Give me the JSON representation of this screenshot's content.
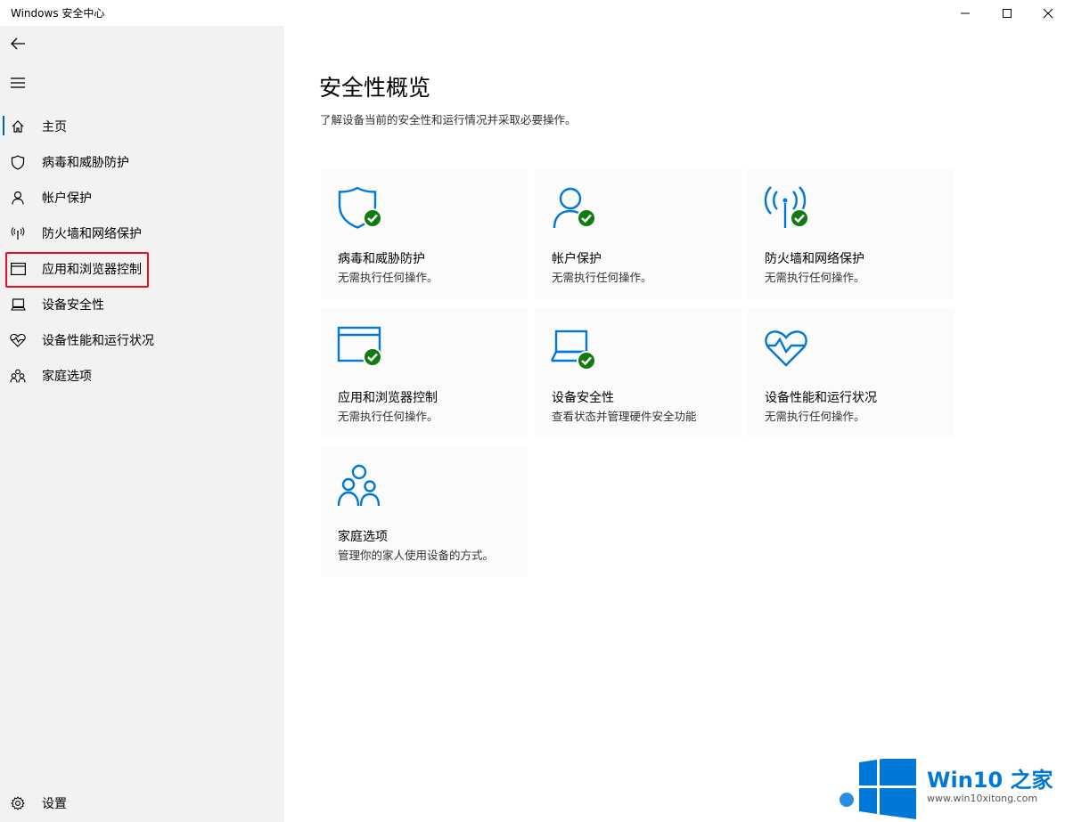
{
  "window": {
    "title": "Windows 安全中心"
  },
  "titlebar_buttons": [
    "minimize-icon",
    "maximize-icon",
    "close-icon"
  ],
  "sidebar": {
    "back_icon": "back-arrow-icon",
    "menu_icon": "hamburger-icon",
    "items": [
      {
        "label": "主页",
        "icon": "home-icon",
        "active": true
      },
      {
        "label": "病毒和威胁防护",
        "icon": "shield-icon"
      },
      {
        "label": "帐户保护",
        "icon": "person-icon"
      },
      {
        "label": "防火墙和网络保护",
        "icon": "antenna-icon"
      },
      {
        "label": "应用和浏览器控制",
        "icon": "browser-window-icon",
        "highlighted": true
      },
      {
        "label": "设备安全性",
        "icon": "laptop-icon"
      },
      {
        "label": "设备性能和运行状况",
        "icon": "heart-pulse-icon"
      },
      {
        "label": "家庭选项",
        "icon": "family-icon"
      }
    ],
    "settings": {
      "label": "设置",
      "icon": "gear-icon"
    }
  },
  "main": {
    "title": "安全性概览",
    "subtitle": "了解设备当前的安全性和运行情况并采取必要操作。",
    "tiles": [
      {
        "title": "病毒和威胁防护",
        "desc": "无需执行任何操作。",
        "icon": "shield-check-icon",
        "status": "ok"
      },
      {
        "title": "帐户保护",
        "desc": "无需执行任何操作。",
        "icon": "person-check-icon",
        "status": "ok"
      },
      {
        "title": "防火墙和网络保护",
        "desc": "无需执行任何操作。",
        "icon": "antenna-check-icon",
        "status": "ok"
      },
      {
        "title": "应用和浏览器控制",
        "desc": "无需执行任何操作。",
        "icon": "browser-check-icon",
        "status": "ok"
      },
      {
        "title": "设备安全性",
        "desc": "查看状态并管理硬件安全功能",
        "icon": "laptop-check-icon",
        "status": "ok"
      },
      {
        "title": "设备性能和运行状况",
        "desc": "无需执行任何操作。",
        "icon": "heart-pulse-icon"
      },
      {
        "title": "家庭选项",
        "desc": "管理你的家人使用设备的方式。",
        "icon": "family-icon"
      }
    ]
  },
  "watermark": {
    "brand": "Win10 之家",
    "url": "www.win10xitong.com"
  },
  "colors": {
    "accent": "#0078d7",
    "ok": "#107c10",
    "sidebar_bg": "#f2f2f2",
    "tile_bg": "#fbfbfb",
    "highlight": "#e81123"
  }
}
